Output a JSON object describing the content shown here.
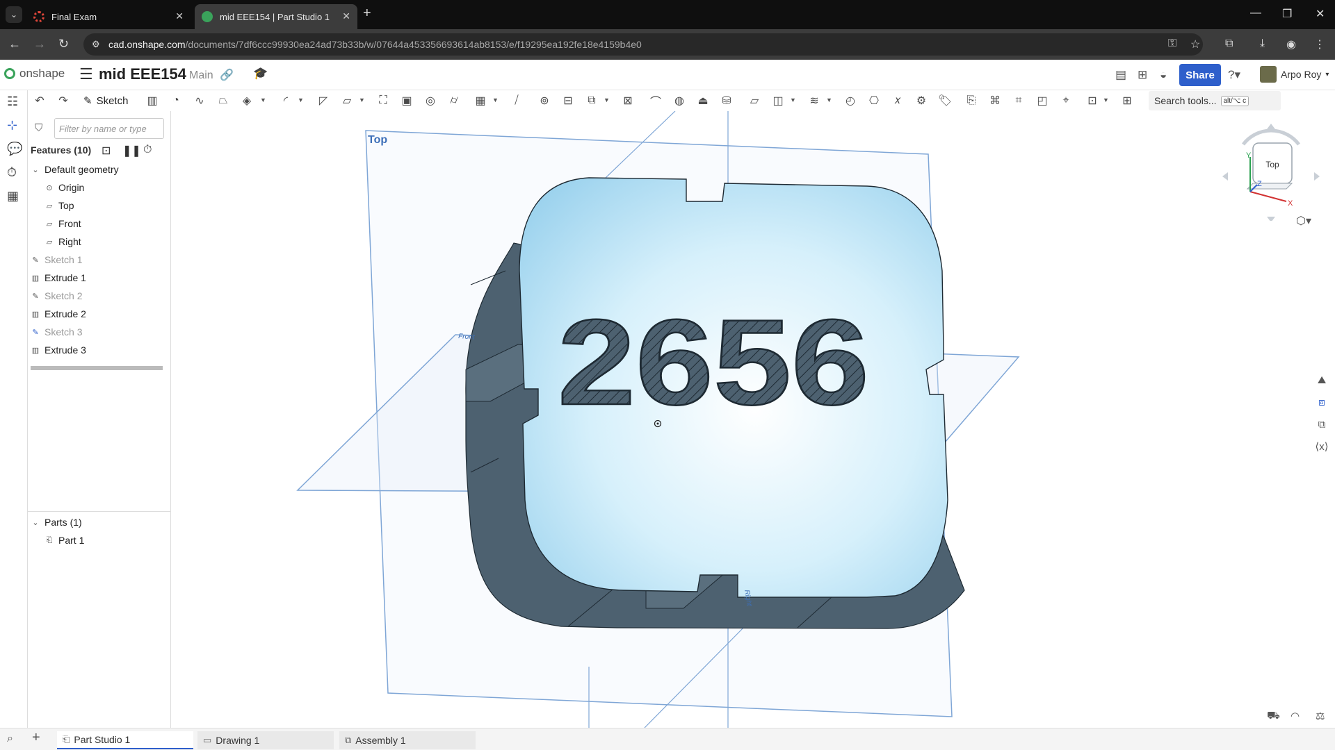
{
  "browser": {
    "tabs": [
      {
        "title": "Final Exam",
        "fav_color": "#e0463a"
      },
      {
        "title": "mid EEE154 | Part Studio 1",
        "fav_color": "#3aa35b"
      }
    ],
    "url_host": "cad.onshape.com",
    "url_path": "/documents/7df6ccc99930ea24ad73b33b/w/07644a453356693614ab8153/e/f19295ea192fe18e4159b4e0"
  },
  "header": {
    "logo_text": "onshape",
    "document_name": "mid EEE154",
    "branch": "Main",
    "share_label": "Share",
    "user_name": "Arpo Roy"
  },
  "toolbar": {
    "sketch_label": "Sketch",
    "search_label": "Search tools...",
    "search_shortcut": "alt/⌥ c"
  },
  "features": {
    "filter_placeholder": "Filter by name or type",
    "header": "Features (10)",
    "default_geometry": "Default geometry",
    "origin": "Origin",
    "planes": [
      "Top",
      "Front",
      "Right"
    ],
    "items": [
      {
        "label": "Sketch 1",
        "kind": "sketch"
      },
      {
        "label": "Extrude 1",
        "kind": "extrude"
      },
      {
        "label": "Sketch 2",
        "kind": "sketch"
      },
      {
        "label": "Extrude 2",
        "kind": "extrude"
      },
      {
        "label": "Sketch 3",
        "kind": "sketch"
      },
      {
        "label": "Extrude 3",
        "kind": "extrude"
      }
    ],
    "parts_header": "Parts (1)",
    "parts": [
      "Part 1"
    ]
  },
  "viewport": {
    "top_plane_label": "Top",
    "front_plane_label": "Front",
    "right_plane_label": "Right",
    "extruded_text": "2656",
    "viewcube_face": "Top",
    "axis_x": "X",
    "axis_y": "Y",
    "axis_z": "Z"
  },
  "bottom_tabs": [
    "Part Studio 1",
    "Drawing 1",
    "Assembly 1"
  ],
  "colors": {
    "accent": "#2e5fcb",
    "part_face": "#bfe6f7",
    "part_side": "#4d6170",
    "plane": "#7fa6d6"
  }
}
